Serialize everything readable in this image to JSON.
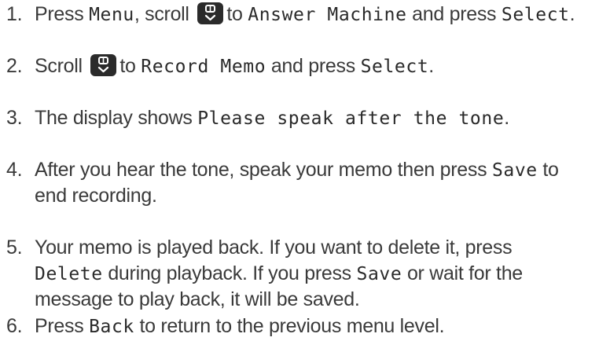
{
  "steps": [
    {
      "number": "1.",
      "parts": [
        "Press ",
        "Menu",
        ", scroll ",
        "to ",
        "Answer Machine",
        " and press ",
        "Select",
        "."
      ]
    },
    {
      "number": "2.",
      "parts": [
        "Scroll ",
        "to ",
        "Record Memo",
        " and press ",
        "Select",
        "."
      ]
    },
    {
      "number": "3.",
      "parts": [
        "The display shows ",
        "Please speak after the tone",
        "."
      ]
    },
    {
      "number": "4.",
      "line1": [
        "After you hear the tone, speak your memo then press ",
        "Save",
        " to"
      ],
      "line2": "end recording."
    },
    {
      "number": "5.",
      "line1": "Your memo is played back. If you want to delete it, press",
      "line2": [
        "Delete",
        " during playback. If you press ",
        "Save",
        " or wait for the"
      ],
      "line3": "message to play back, it will be saved."
    },
    {
      "number": "6.",
      "parts": [
        "Press ",
        "Back",
        " to return to the previous menu level."
      ]
    }
  ],
  "icons": {
    "scroll": "scroll-up-down-icon"
  },
  "colors": {
    "text": "#3a3a3a",
    "key_background": "#2b2b2b",
    "key_glyph": "#ffffff"
  }
}
